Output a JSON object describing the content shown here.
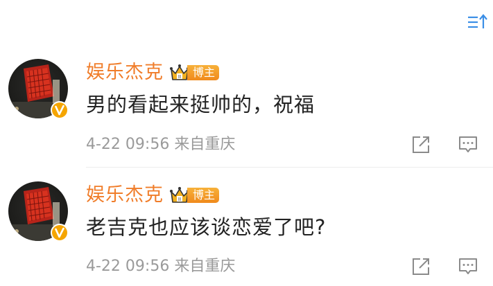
{
  "toolbar": {
    "sort_icon": "sort-icon"
  },
  "comments": [
    {
      "author": "娱乐杰克",
      "badge_label": "博主",
      "text": "男的看起来挺帅的，祝福",
      "time": "4-22 09:56",
      "location": "来自重庆"
    },
    {
      "author": "娱乐杰克",
      "badge_label": "博主",
      "text": "老吉克也应该谈恋爱了吧?",
      "time": "4-22 09:56",
      "location": "来自重庆"
    }
  ],
  "colors": {
    "author": "#f07d2a",
    "badge": "#f5a623",
    "meta": "#9a9a9a",
    "accent_icon": "#3a8ee6"
  }
}
